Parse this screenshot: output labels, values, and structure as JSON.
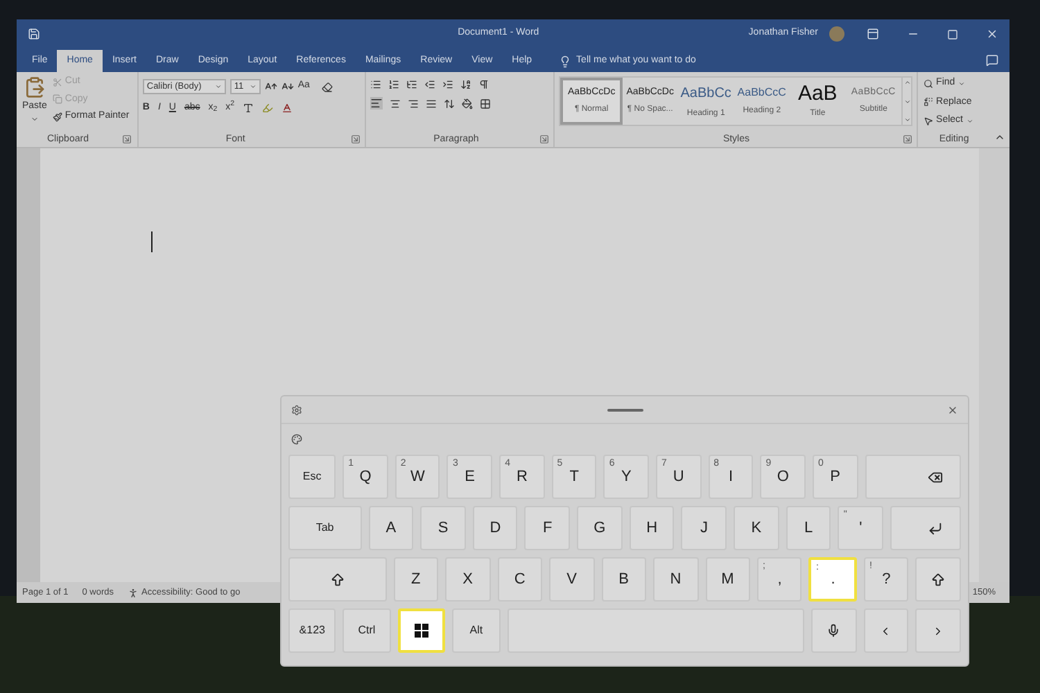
{
  "title_bar": {
    "title": "Document1 - Word",
    "user": "Jonathan Fisher"
  },
  "ribbon_tabs": [
    {
      "label": "File",
      "selected": false
    },
    {
      "label": "Home",
      "selected": true
    },
    {
      "label": "Insert",
      "selected": false
    },
    {
      "label": "Draw",
      "selected": false
    },
    {
      "label": "Design",
      "selected": false
    },
    {
      "label": "Layout",
      "selected": false
    },
    {
      "label": "References",
      "selected": false
    },
    {
      "label": "Mailings",
      "selected": false
    },
    {
      "label": "Review",
      "selected": false
    },
    {
      "label": "View",
      "selected": false
    },
    {
      "label": "Help",
      "selected": false
    }
  ],
  "tell_me": "Tell me what you want to do",
  "clipboard": {
    "paste": "Paste",
    "cut": {
      "label": "Cut",
      "disabled": true
    },
    "copy": {
      "label": "Copy",
      "disabled": true
    },
    "format_painter": {
      "label": "Format Painter",
      "disabled": false
    },
    "group_label": "Clipboard"
  },
  "font": {
    "family": "Calibri (Body)",
    "size": "11",
    "change_case": "Aa",
    "bold": "B",
    "italic": "I",
    "underline": "U",
    "strikethrough": "abc",
    "subscript": "x$_{2}$",
    "superscript": "x$^{2}$",
    "group_label": "Font"
  },
  "paragraph": {
    "group_label": "Paragraph"
  },
  "styles": {
    "items": [
      {
        "kind": "normal",
        "sample": "AaBbCcDc",
        "name": "¶ Normal",
        "selected": true
      },
      {
        "kind": "nospacing",
        "sample": "AaBbCcDc",
        "name": "¶ No Spac...",
        "selected": false
      },
      {
        "kind": "heading1",
        "sample": "AaBbCc",
        "name": "Heading 1",
        "selected": false
      },
      {
        "kind": "heading2",
        "sample": "AaBbCcC",
        "name": "Heading 2",
        "selected": false
      },
      {
        "kind": "title",
        "sample": "AaB",
        "name": "Title",
        "selected": false
      },
      {
        "kind": "subtitle",
        "sample": "AaBbCcC",
        "name": "Subtitle",
        "selected": false
      }
    ],
    "group_label": "Styles"
  },
  "editing": {
    "find": "Find",
    "replace": "Replace",
    "select": "Select",
    "group_label": "Editing"
  },
  "status_bar": {
    "page": "Page 1 of 1",
    "words": "0 words",
    "accessibility": "Accessibility: Good to go",
    "zoom": "150%"
  },
  "keyboard": {
    "rows": [
      [
        {
          "kind": "esc",
          "label": "Esc",
          "highlighted": false
        },
        {
          "kind": "letter",
          "label": "Q",
          "hint": "1",
          "highlighted": false
        },
        {
          "kind": "letter",
          "label": "W",
          "hint": "2",
          "highlighted": false
        },
        {
          "kind": "letter",
          "label": "E",
          "hint": "3",
          "highlighted": false
        },
        {
          "kind": "letter",
          "label": "R",
          "hint": "4",
          "highlighted": false
        },
        {
          "kind": "letter",
          "label": "T",
          "hint": "5",
          "highlighted": false
        },
        {
          "kind": "letter",
          "label": "Y",
          "hint": "6",
          "highlighted": false
        },
        {
          "kind": "letter",
          "label": "U",
          "hint": "7",
          "highlighted": false
        },
        {
          "kind": "letter",
          "label": "I",
          "hint": "8",
          "highlighted": false
        },
        {
          "kind": "letter",
          "label": "O",
          "hint": "9",
          "highlighted": false
        },
        {
          "kind": "letter",
          "label": "P",
          "hint": "0",
          "highlighted": false
        },
        {
          "kind": "backspace",
          "highlighted": false
        }
      ],
      [
        {
          "kind": "tab",
          "label": "Tab",
          "highlighted": false
        },
        {
          "kind": "letter",
          "label": "A",
          "highlighted": false
        },
        {
          "kind": "letter",
          "label": "S",
          "highlighted": false
        },
        {
          "kind": "letter",
          "label": "D",
          "highlighted": false
        },
        {
          "kind": "letter",
          "label": "F",
          "highlighted": false
        },
        {
          "kind": "letter",
          "label": "G",
          "highlighted": false
        },
        {
          "kind": "letter",
          "label": "H",
          "highlighted": false
        },
        {
          "kind": "letter",
          "label": "J",
          "highlighted": false
        },
        {
          "kind": "letter",
          "label": "K",
          "highlighted": false
        },
        {
          "kind": "letter",
          "label": "L",
          "highlighted": false
        },
        {
          "kind": "letter",
          "label": "'",
          "hint": "\"",
          "highlighted": false
        },
        {
          "kind": "enter",
          "highlighted": false
        }
      ],
      [
        {
          "kind": "shift",
          "highlighted": false
        },
        {
          "kind": "letter",
          "label": "Z",
          "highlighted": false
        },
        {
          "kind": "letter",
          "label": "X",
          "highlighted": false
        },
        {
          "kind": "letter",
          "label": "C",
          "highlighted": false
        },
        {
          "kind": "letter",
          "label": "V",
          "highlighted": false
        },
        {
          "kind": "letter",
          "label": "B",
          "highlighted": false
        },
        {
          "kind": "letter",
          "label": "N",
          "highlighted": false
        },
        {
          "kind": "letter",
          "label": "M",
          "highlighted": false
        },
        {
          "kind": "letter",
          "label": ",",
          "hint": ";",
          "highlighted": false
        },
        {
          "kind": "letter",
          "label": ".",
          "hint": ":",
          "highlighted": true
        },
        {
          "kind": "letter",
          "label": "?",
          "hint": "!",
          "highlighted": false
        },
        {
          "kind": "shift",
          "highlighted": false
        }
      ],
      [
        {
          "kind": "symbols",
          "label": "&123",
          "highlighted": false
        },
        {
          "kind": "ctrl",
          "label": "Ctrl",
          "highlighted": false
        },
        {
          "kind": "windows",
          "highlighted": true
        },
        {
          "kind": "alt",
          "label": "Alt",
          "highlighted": false
        },
        {
          "kind": "space",
          "highlighted": false
        },
        {
          "kind": "mic",
          "highlighted": false
        },
        {
          "kind": "left",
          "highlighted": false
        },
        {
          "kind": "right",
          "highlighted": false
        }
      ]
    ]
  }
}
